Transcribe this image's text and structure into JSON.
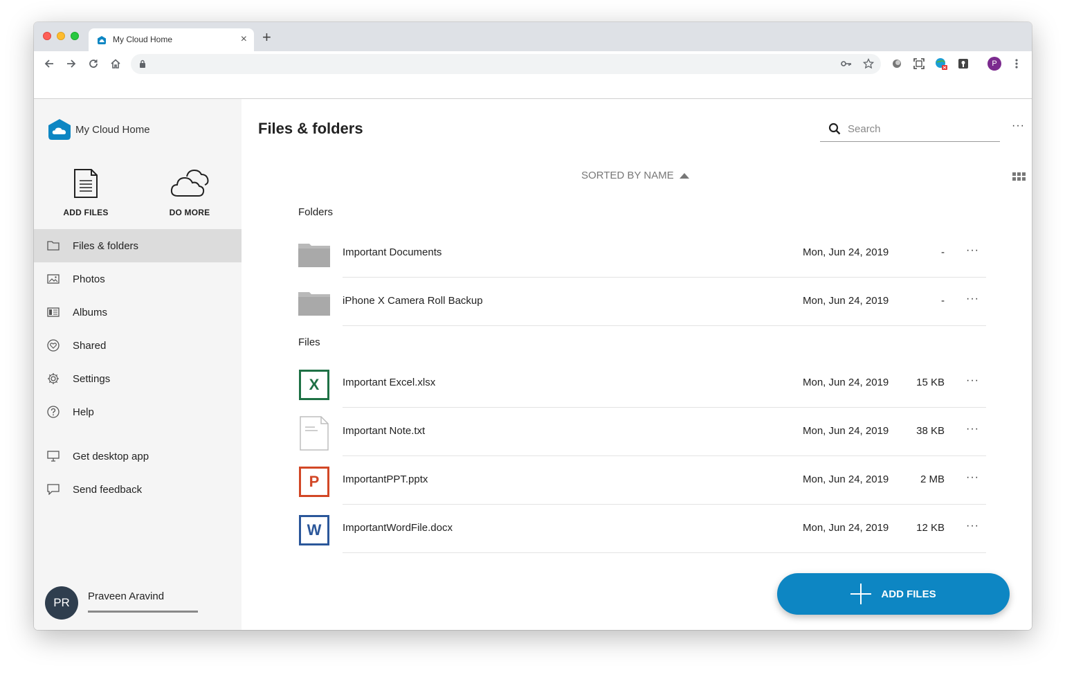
{
  "browser": {
    "tab_title": "My Cloud Home",
    "close_glyph": "×",
    "new_tab_glyph": "+",
    "profile_initial": "P"
  },
  "sidebar": {
    "brand_name": "My Cloud Home",
    "quick_actions": [
      {
        "label": "ADD FILES",
        "icon": "document-icon"
      },
      {
        "label": "DO MORE",
        "icon": "cloud-icon"
      }
    ],
    "nav": [
      {
        "label": "Files & folders",
        "icon": "folder-outline-icon",
        "active": true
      },
      {
        "label": "Photos",
        "icon": "image-icon",
        "active": false
      },
      {
        "label": "Albums",
        "icon": "album-icon",
        "active": false
      },
      {
        "label": "Shared",
        "icon": "heart-circle-icon",
        "active": false
      },
      {
        "label": "Settings",
        "icon": "gear-icon",
        "active": false
      },
      {
        "label": "Help",
        "icon": "help-icon",
        "active": false
      },
      {
        "label": "Get desktop app",
        "icon": "monitor-icon",
        "active": false
      },
      {
        "label": "Send feedback",
        "icon": "speech-bubble-icon",
        "active": false
      }
    ],
    "user": {
      "initials": "PR",
      "name": "Praveen Aravind"
    }
  },
  "main": {
    "title": "Files & folders",
    "search_placeholder": "Search",
    "more_glyph": "···",
    "sort_label": "SORTED BY NAME",
    "folders_label": "Folders",
    "files_label": "Files",
    "folders": [
      {
        "name": "Important Documents",
        "date": "Mon, Jun 24, 2019",
        "size": "-"
      },
      {
        "name": "iPhone X Camera Roll Backup",
        "date": "Mon, Jun 24, 2019",
        "size": "-"
      }
    ],
    "files": [
      {
        "name": "Important Excel.xlsx",
        "date": "Mon, Jun 24, 2019",
        "size": "15 KB",
        "type": "excel",
        "letter": "X",
        "color": "#1e7145"
      },
      {
        "name": "Important Note.txt",
        "date": "Mon, Jun 24, 2019",
        "size": "38 KB",
        "type": "text",
        "letter": "",
        "color": "#bdbdbd"
      },
      {
        "name": "ImportantPPT.pptx",
        "date": "Mon, Jun 24, 2019",
        "size": "2 MB",
        "type": "powerpoint",
        "letter": "P",
        "color": "#d24726"
      },
      {
        "name": "ImportantWordFile.docx",
        "date": "Mon, Jun 24, 2019",
        "size": "12 KB",
        "type": "word",
        "letter": "W",
        "color": "#2b579a"
      }
    ],
    "fab_label": "ADD FILES"
  },
  "colors": {
    "brand": "#0d86c3",
    "sidebar_bg": "#f5f5f5",
    "active_bg": "#dcdcdc"
  }
}
